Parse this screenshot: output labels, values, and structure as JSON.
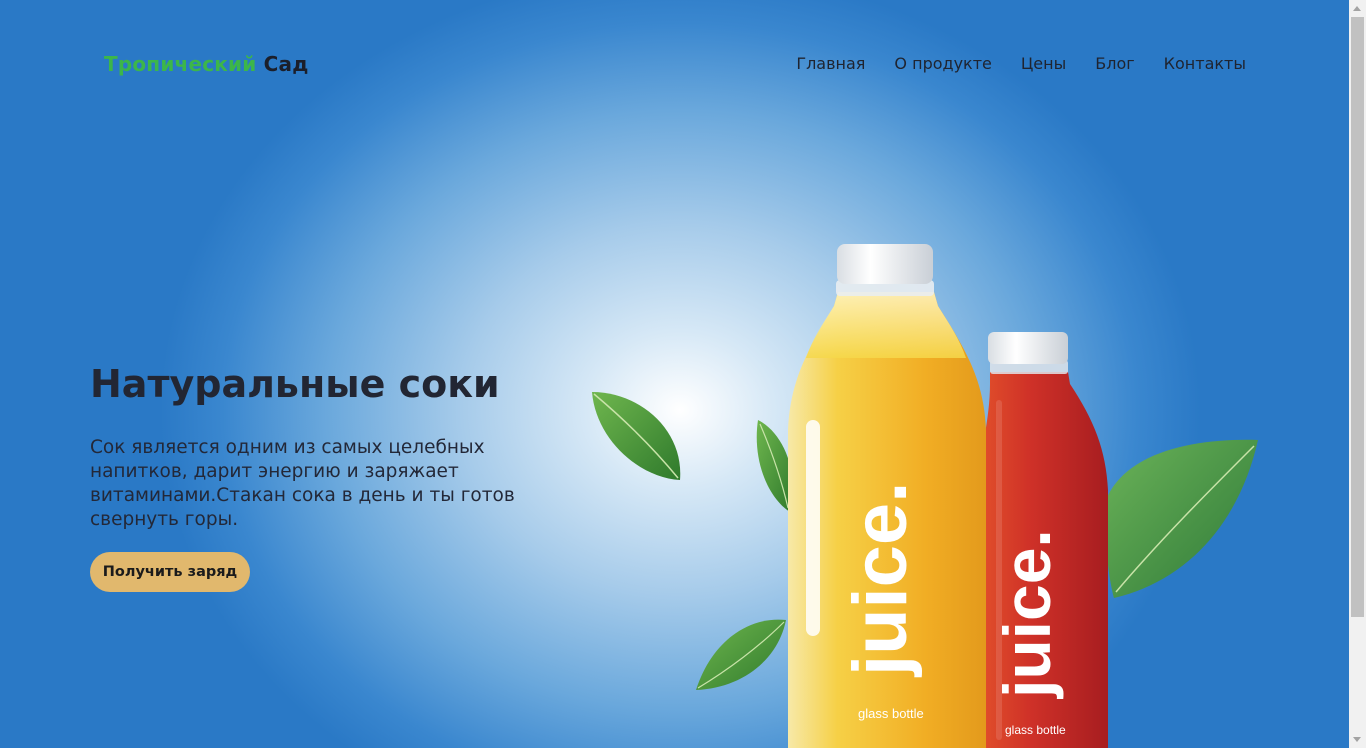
{
  "header": {
    "logo_part1": "Тропический",
    "logo_part2": "Сад",
    "nav": [
      "Главная",
      "О продукте",
      "Цены",
      "Блог",
      "Контакты"
    ]
  },
  "hero": {
    "title": "Натуральные соки",
    "description": "Сок является одним из самых целебных напитков, дарит энергию и заряжает витаминами.Стакан сока в день и ты готов свернуть горы.",
    "cta_label": "Получить заряд"
  },
  "product_image": {
    "bottle_brand": "juice.",
    "bottle_caption": "glass bottle",
    "colors": {
      "yellow_juice": "#f2b128",
      "red_juice": "#c42a24",
      "leaf": "#4e9a3a",
      "cta": "#e1b86d",
      "logo_green": "#3cb64a"
    }
  }
}
